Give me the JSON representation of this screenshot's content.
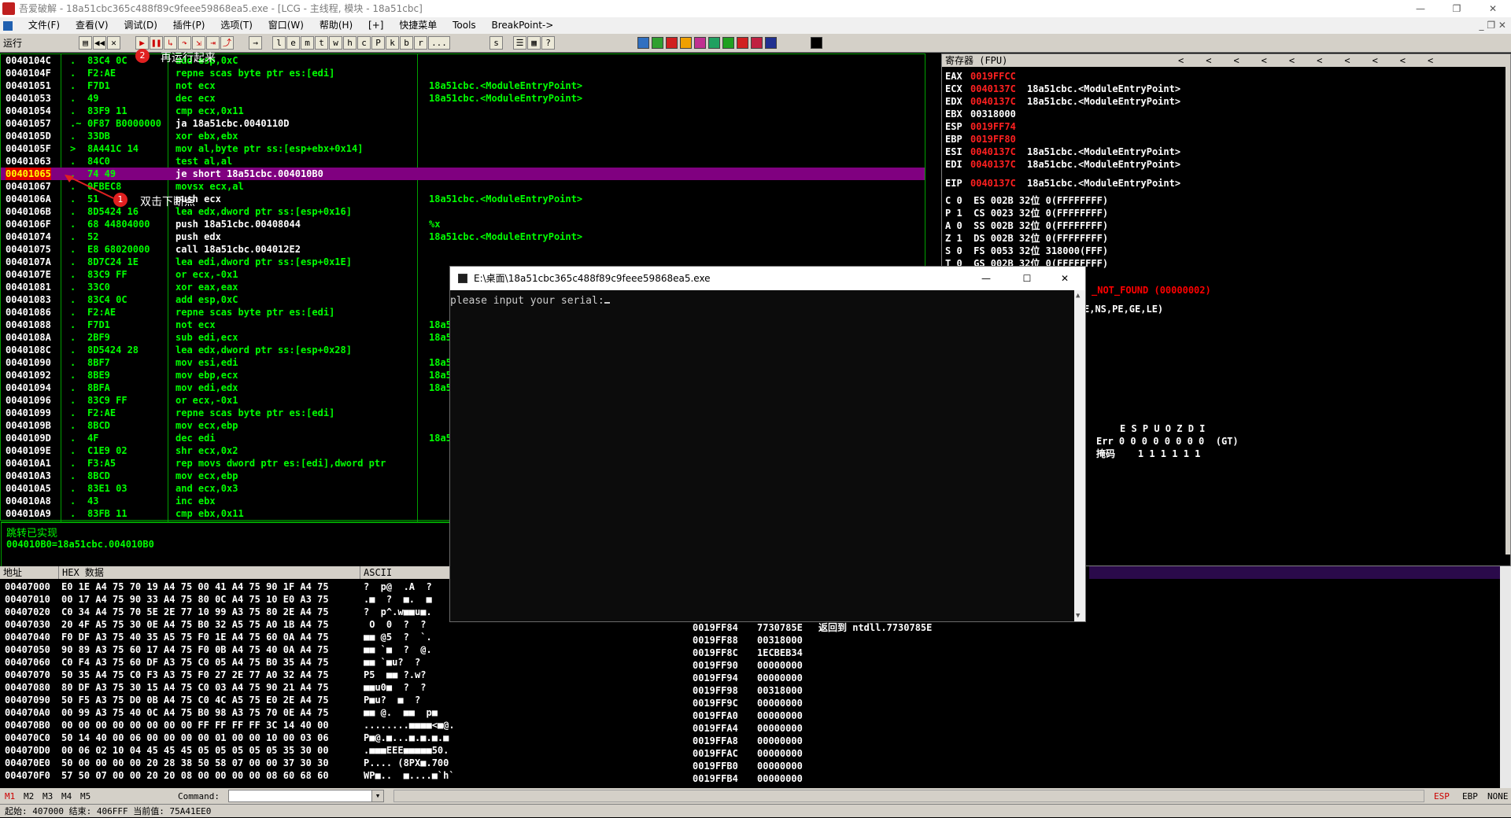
{
  "window": {
    "title": "吾爱破解 - 18a51cbc365c488f89c9feee59868ea5.exe - [LCG - 主线程, 模块 - 18a51cbc]"
  },
  "menu": [
    "文件(F)",
    "查看(V)",
    "调试(D)",
    "插件(P)",
    "选项(T)",
    "窗口(W)",
    "帮助(H)",
    "[+]",
    "快捷菜单",
    "Tools",
    "BreakPoint->"
  ],
  "toolbar": {
    "status": "运行",
    "letters": [
      "l",
      "e",
      "m",
      "t",
      "w",
      "h",
      "c",
      "P",
      "k",
      "b",
      "r",
      "...",
      "s"
    ],
    "accent_colors": [
      "#3070c0",
      "#30a030",
      "#d02020",
      "#f0a000",
      "#c03090",
      "#20a060",
      "#20a020",
      "#d02020",
      "#c02040",
      "#203090",
      "#000000"
    ]
  },
  "cpu": {
    "rows": [
      {
        "addr": "0040104C",
        "mark": ".",
        "hex": "83C4 0C",
        "asm": "add esp,0xC",
        "cmt": ""
      },
      {
        "addr": "0040104F",
        "mark": ".",
        "hex": "F2:AE",
        "asm": "repne scas byte ptr es:[edi]",
        "cmt": ""
      },
      {
        "addr": "00401051",
        "mark": ".",
        "hex": "F7D1",
        "asm": "not ecx",
        "cmt": "18a51cbc.<ModuleEntryPoint>"
      },
      {
        "addr": "00401053",
        "mark": ".",
        "hex": "49",
        "asm": "dec ecx",
        "cmt": "18a51cbc.<ModuleEntryPoint>"
      },
      {
        "addr": "00401054",
        "mark": ".",
        "hex": "83F9 11",
        "asm": "cmp ecx,0x11",
        "cmt": ""
      },
      {
        "addr": "00401057",
        "mark": ".~",
        "hex": "0F87 B0000000",
        "asm": "ja 18a51cbc.0040110D",
        "cmt": ""
      },
      {
        "addr": "0040105D",
        "mark": ".",
        "hex": "33DB",
        "asm": "xor ebx,ebx",
        "cmt": ""
      },
      {
        "addr": "0040105F",
        "mark": ">",
        "hex": "8A441C 14",
        "asm": "mov al,byte ptr ss:[esp+ebx+0x14]",
        "cmt": ""
      },
      {
        "addr": "00401063",
        "mark": ".",
        "hex": "84C0",
        "asm": "test al,al",
        "cmt": ""
      },
      {
        "addr": "00401065",
        "mark": ".",
        "hex": "74 49",
        "asm": "je short 18a51cbc.004010B0",
        "cmt": ""
      },
      {
        "addr": "00401067",
        "mark": ".",
        "hex": "0FBEC8",
        "asm": "movsx ecx,al",
        "cmt": ""
      },
      {
        "addr": "0040106A",
        "mark": ".",
        "hex": "51",
        "asm": "push ecx",
        "cmt": "18a51cbc.<ModuleEntryPoint>"
      },
      {
        "addr": "0040106B",
        "mark": ".",
        "hex": "8D5424 16",
        "asm": "lea edx,dword ptr ss:[esp+0x16]",
        "cmt": ""
      },
      {
        "addr": "0040106F",
        "mark": ".",
        "hex": "68 44804000",
        "asm": "push 18a51cbc.00408044",
        "cmt": "%x"
      },
      {
        "addr": "00401074",
        "mark": ".",
        "hex": "52",
        "asm": "push edx",
        "cmt": "18a51cbc.<ModuleEntryPoint>"
      },
      {
        "addr": "00401075",
        "mark": ".",
        "hex": "E8 68020000",
        "asm": "call 18a51cbc.004012E2",
        "cmt": ""
      },
      {
        "addr": "0040107A",
        "mark": ".",
        "hex": "8D7C24 1E",
        "asm": "lea edi,dword ptr ss:[esp+0x1E]",
        "cmt": ""
      },
      {
        "addr": "0040107E",
        "mark": ".",
        "hex": "83C9 FF",
        "asm": "or ecx,-0x1",
        "cmt": ""
      },
      {
        "addr": "00401081",
        "mark": ".",
        "hex": "33C0",
        "asm": "xor eax,eax",
        "cmt": ""
      },
      {
        "addr": "00401083",
        "mark": ".",
        "hex": "83C4 0C",
        "asm": "add esp,0xC",
        "cmt": ""
      },
      {
        "addr": "00401086",
        "mark": ".",
        "hex": "F2:AE",
        "asm": "repne scas byte ptr es:[edi]",
        "cmt": ""
      },
      {
        "addr": "00401088",
        "mark": ".",
        "hex": "F7D1",
        "asm": "not ecx",
        "cmt": "18a5"
      },
      {
        "addr": "0040108A",
        "mark": ".",
        "hex": "2BF9",
        "asm": "sub edi,ecx",
        "cmt": "18a5"
      },
      {
        "addr": "0040108C",
        "mark": ".",
        "hex": "8D5424 28",
        "asm": "lea edx,dword ptr ss:[esp+0x28]",
        "cmt": ""
      },
      {
        "addr": "00401090",
        "mark": ".",
        "hex": "8BF7",
        "asm": "mov esi,edi",
        "cmt": "18a5"
      },
      {
        "addr": "00401092",
        "mark": ".",
        "hex": "8BE9",
        "asm": "mov ebp,ecx",
        "cmt": "18a5"
      },
      {
        "addr": "00401094",
        "mark": ".",
        "hex": "8BFA",
        "asm": "mov edi,edx",
        "cmt": "18a5"
      },
      {
        "addr": "00401096",
        "mark": ".",
        "hex": "83C9 FF",
        "asm": "or ecx,-0x1",
        "cmt": ""
      },
      {
        "addr": "00401099",
        "mark": ".",
        "hex": "F2:AE",
        "asm": "repne scas byte ptr es:[edi]",
        "cmt": ""
      },
      {
        "addr": "0040109B",
        "mark": ".",
        "hex": "8BCD",
        "asm": "mov ecx,ebp",
        "cmt": ""
      },
      {
        "addr": "0040109D",
        "mark": ".",
        "hex": "4F",
        "asm": "dec edi",
        "cmt": "18a5"
      },
      {
        "addr": "0040109E",
        "mark": ".",
        "hex": "C1E9 02",
        "asm": "shr ecx,0x2",
        "cmt": ""
      },
      {
        "addr": "004010A1",
        "mark": ".",
        "hex": "F3:A5",
        "asm": "rep movs dword ptr es:[edi],dword ptr",
        "cmt": ""
      },
      {
        "addr": "004010A3",
        "mark": ".",
        "hex": "8BCD",
        "asm": "mov ecx,ebp",
        "cmt": ""
      },
      {
        "addr": "004010A5",
        "mark": ".",
        "hex": "83E1 03",
        "asm": "and ecx,0x3",
        "cmt": ""
      },
      {
        "addr": "004010A8",
        "mark": ".",
        "hex": "43",
        "asm": "inc ebx",
        "cmt": ""
      },
      {
        "addr": "004010A9",
        "mark": ".",
        "hex": "83FB 11",
        "asm": "cmp ebx,0x11",
        "cmt": ""
      }
    ],
    "info_line1": "跳转已实现",
    "info_line2": "004010B0=18a51cbc.004010B0"
  },
  "registers": {
    "header": "寄存器 (FPU)",
    "rows": [
      {
        "name": "EAX",
        "value": "0019FFCC",
        "note": ""
      },
      {
        "name": "ECX",
        "value": "0040137C",
        "note": "18a51cbc.<ModuleEntryPoint>"
      },
      {
        "name": "EDX",
        "value": "0040137C",
        "note": "18a51cbc.<ModuleEntryPoint>"
      },
      {
        "name": "EBX",
        "value": "00318000",
        "note": ""
      },
      {
        "name": "ESP",
        "value": "0019FF74",
        "note": ""
      },
      {
        "name": "EBP",
        "value": "0019FF80",
        "note": ""
      },
      {
        "name": "ESI",
        "value": "0040137C",
        "note": "18a51cbc.<ModuleEntryPoint>"
      },
      {
        "name": "EDI",
        "value": "0040137C",
        "note": "18a51cbc.<ModuleEntryPoint>"
      },
      {
        "name": "EIP",
        "value": "0040137C",
        "note": "18a51cbc.<ModuleEntryPoint>"
      }
    ],
    "flags": [
      "C 0  ES 002B 32位 0(FFFFFFFF)",
      "P 1  CS 0023 32位 0(FFFFFFFF)",
      "A 0  SS 002B 32位 0(FFFFFFFF)",
      "Z 1  DS 002B 32位 0(FFFFFFFF)",
      "S 0  FS 0053 32位 318000(FFF)",
      "T 0  GS 002B 32位 0(FFFFFFFF)"
    ],
    "lasterr": "_NOT_FOUND (00000002)",
    "cond": "E,NS,PE,GE,LE)",
    "fpu_head": "E S P U O Z D I",
    "fpu_err": "Err 0 0 0 0 0 0 0 0  (GT)",
    "fpu_mask": "掩码    1 1 1 1 1 1"
  },
  "dump": {
    "headers": [
      "地址",
      "HEX 数据",
      "ASCII"
    ],
    "rows": [
      {
        "addr": "00407000",
        "hex": "E0 1E A4 75 70 19 A4 75 00 41 A4 75 90 1F A4 75",
        "ascii": "?  p@  .A  ?"
      },
      {
        "addr": "00407010",
        "hex": "00 17 A4 75 90 33 A4 75 80 0C A4 75 10 E0 A3 75",
        "ascii": ".■  ?  ■.  ■"
      },
      {
        "addr": "00407020",
        "hex": "C0 34 A4 75 70 5E 2E 77 10 99 A3 75 80 2E A4 75",
        "ascii": "?  p^.w■■u■."
      },
      {
        "addr": "00407030",
        "hex": "20 4F A5 75 30 0E A4 75 B0 32 A5 75 A0 1B A4 75",
        "ascii": " O  0  ?  ?"
      },
      {
        "addr": "00407040",
        "hex": "F0 DF A3 75 40 35 A5 75 F0 1E A4 75 60 0A A4 75",
        "ascii": "■■ @5  ?  `."
      },
      {
        "addr": "00407050",
        "hex": "90 89 A3 75 60 17 A4 75 F0 0B A4 75 40 0A A4 75",
        "ascii": "■■ `■  ?  @."
      },
      {
        "addr": "00407060",
        "hex": "C0 F4 A3 75 60 DF A3 75 C0 05 A4 75 B0 35 A4 75",
        "ascii": "■■ `■u?  ?"
      },
      {
        "addr": "00407070",
        "hex": "50 35 A4 75 C0 F3 A3 75 F0 27 2E 77 A0 32 A4 75",
        "ascii": "P5  ■■ ?.w?"
      },
      {
        "addr": "00407080",
        "hex": "80 DF A3 75 30 15 A4 75 C0 03 A4 75 90 21 A4 75",
        "ascii": "■■u0■  ?  ?"
      },
      {
        "addr": "00407090",
        "hex": "50 F5 A3 75 D0 0B A4 75 C0 4C A5 75 E0 2E A4 75",
        "ascii": "P■u?  ■  ?"
      },
      {
        "addr": "004070A0",
        "hex": "00 99 A3 75 40 0C A4 75 B0 98 A3 75 70 0E A4 75",
        "ascii": "■■ @.  ■■  p■"
      },
      {
        "addr": "004070B0",
        "hex": "00 00 00 00 00 00 00 00 FF FF FF FF 3C 14 40 00",
        "ascii": "........■■■■<■@."
      },
      {
        "addr": "004070C0",
        "hex": "50 14 40 00 06 00 00 00 00 01 00 00 10 00 03 06",
        "ascii": "P■@.■...■.■.■.■"
      },
      {
        "addr": "004070D0",
        "hex": "00 06 02 10 04 45 45 45 05 05 05 05 05 35 30 00",
        "ascii": ".■■■EEE■■■■■50."
      },
      {
        "addr": "004070E0",
        "hex": "50 00 00 00 00 20 28 38 50 58 07 00 00 37 30 30",
        "ascii": "P.... (8PX■.700"
      },
      {
        "addr": "004070F0",
        "hex": "57 50 07 00 00 20 20 08 00 00 00 00 08 60 68 60",
        "ascii": "WP■..  ■....■`h`"
      }
    ]
  },
  "stack": {
    "rows": [
      {
        "addr": "0019FF84",
        "value": "7730785E",
        "note": "返回到 ntdll.7730785E"
      },
      {
        "addr": "0019FF88",
        "value": "00318000",
        "note": ""
      },
      {
        "addr": "0019FF8C",
        "value": "1ECBEB34",
        "note": ""
      },
      {
        "addr": "0019FF90",
        "value": "00000000",
        "note": ""
      },
      {
        "addr": "0019FF94",
        "value": "00000000",
        "note": ""
      },
      {
        "addr": "0019FF98",
        "value": "00318000",
        "note": ""
      },
      {
        "addr": "0019FF9C",
        "value": "00000000",
        "note": ""
      },
      {
        "addr": "0019FFA0",
        "value": "00000000",
        "note": ""
      },
      {
        "addr": "0019FFA4",
        "value": "00000000",
        "note": ""
      },
      {
        "addr": "0019FFA8",
        "value": "00000000",
        "note": ""
      },
      {
        "addr": "0019FFAC",
        "value": "00000000",
        "note": ""
      },
      {
        "addr": "0019FFB0",
        "value": "00000000",
        "note": ""
      },
      {
        "addr": "0019FFB4",
        "value": "00000000",
        "note": ""
      }
    ]
  },
  "cmdbar": {
    "m1": "M1",
    "m2": "M2",
    "m3": "M3",
    "m4": "M4",
    "m5": "M5",
    "command_label": "Command:",
    "esp": "ESP",
    "ebp": "EBP",
    "none": "NONE"
  },
  "statusbar": {
    "text": "起始: 407000  结束: 406FFF  当前值: 75A41EE0"
  },
  "console": {
    "title": "E:\\桌面\\18a51cbc365c488f89c9feee59868ea5.exe",
    "prompt": "please input your serial:"
  },
  "annotations": {
    "step1": "1",
    "step1_text": "双击下断点",
    "step2": "2",
    "step2_text": "再运行起来"
  }
}
